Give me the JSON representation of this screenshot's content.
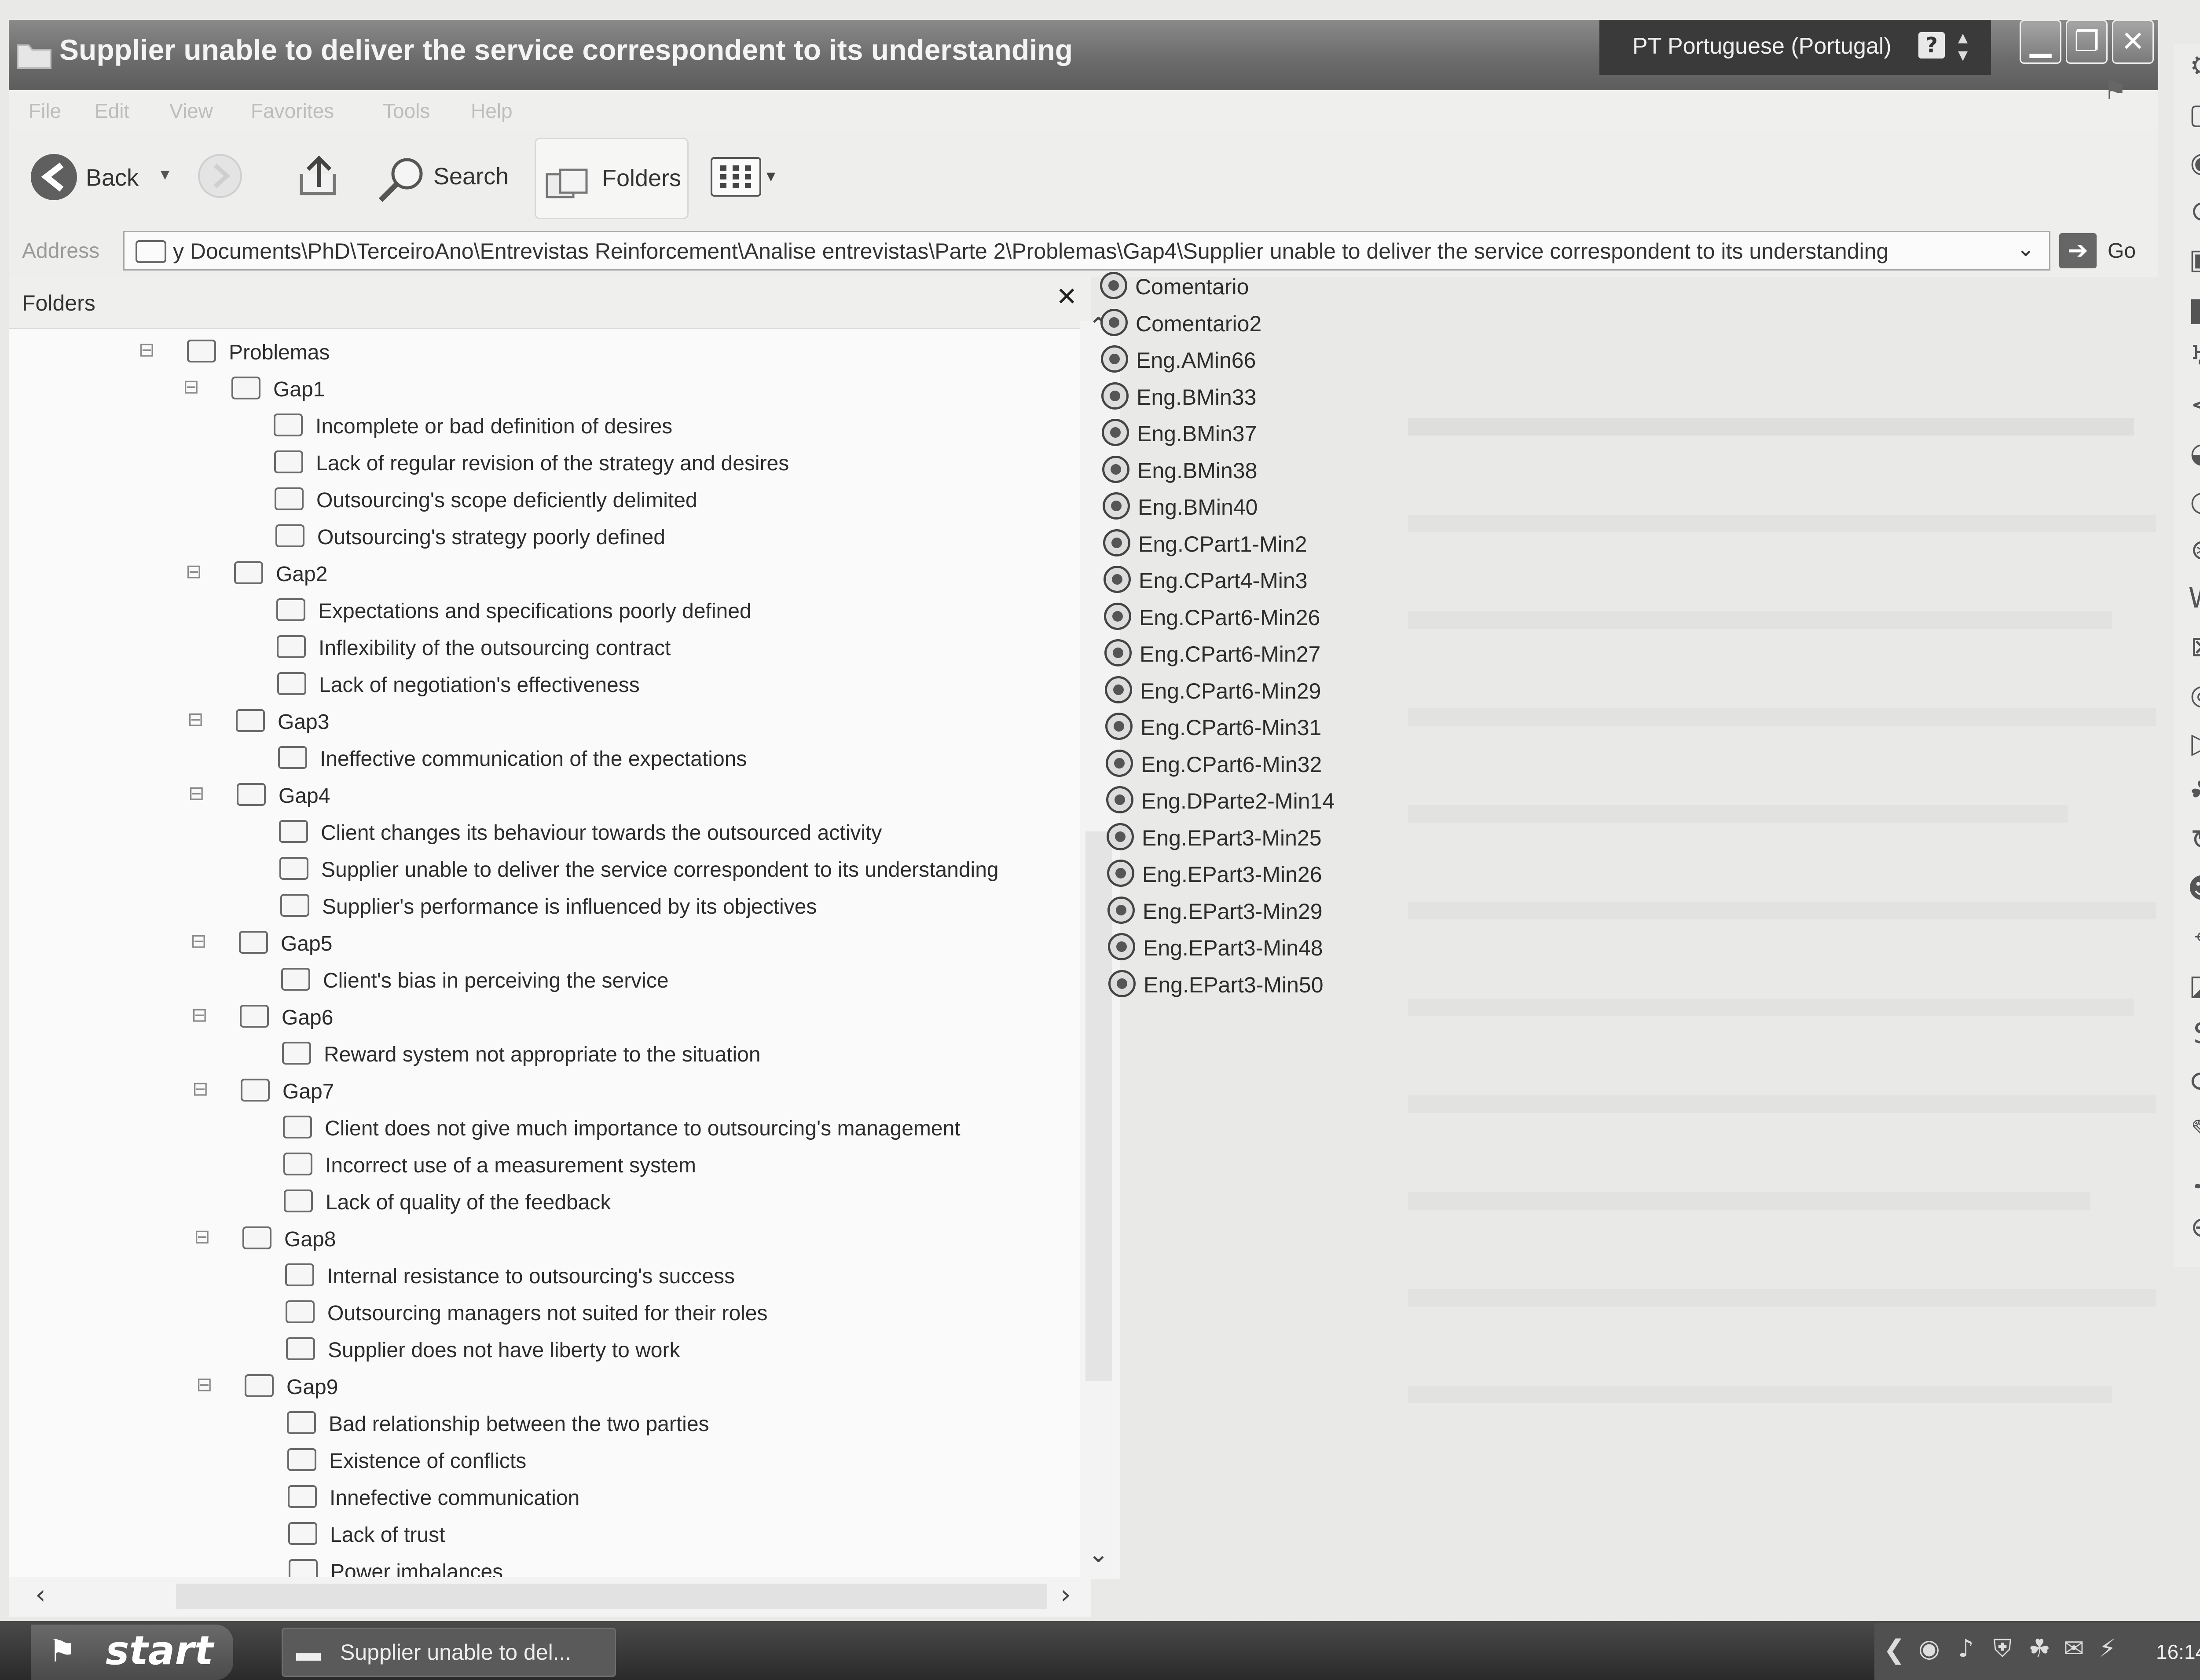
{
  "window": {
    "title": "Supplier unable to deliver the service correspondent to its understanding",
    "language": "PT Portuguese (Portugal)",
    "help_glyph": "?",
    "minimize_glyph": "▁",
    "restore_glyph": "❐",
    "close_glyph": "✕"
  },
  "menu": [
    "File",
    "Edit",
    "View",
    "Favorites",
    "Tools",
    "Help"
  ],
  "toolbar": {
    "back_label": "Back",
    "search_label": "Search",
    "folders_label": "Folders"
  },
  "address": {
    "label": "Address",
    "path": "y Documents\\PhD\\TerceiroAno\\Entrevistas Reinforcement\\Analise entrevistas\\Parte 2\\Problemas\\Gap4\\Supplier unable to deliver the service correspondent to its understanding",
    "go_label": "Go"
  },
  "folders_pane": {
    "title": "Folders",
    "close_glyph": "✕",
    "root": "Problemas",
    "gaps": [
      {
        "name": "Gap1",
        "items": [
          "Incomplete or bad definition of desires",
          "Lack of regular revision of the strategy and desires",
          "Outsourcing's scope deficiently delimited",
          "Outsourcing's strategy poorly defined"
        ]
      },
      {
        "name": "Gap2",
        "items": [
          "Expectations and specifications poorly defined",
          "Inflexibility of the outsourcing contract",
          "Lack of negotiation's effectiveness"
        ]
      },
      {
        "name": "Gap3",
        "items": [
          "Ineffective communication of the expectations"
        ]
      },
      {
        "name": "Gap4",
        "items": [
          "Client changes its behaviour towards the outsourced activity",
          "Supplier unable to deliver the service correspondent to its understanding",
          "Supplier's performance is influenced by its objectives"
        ]
      },
      {
        "name": "Gap5",
        "items": [
          "Client's bias in perceiving the service"
        ]
      },
      {
        "name": "Gap6",
        "items": [
          "Reward system not appropriate to the situation"
        ]
      },
      {
        "name": "Gap7",
        "items": [
          "Client does not give much importance to outsourcing's management",
          "Incorrect use of a measurement system",
          "Lack of quality of the feedback"
        ]
      },
      {
        "name": "Gap8",
        "items": [
          "Internal resistance to outsourcing's success",
          "Outsourcing managers not suited for their roles",
          "Supplier does not have liberty to work"
        ]
      },
      {
        "name": "Gap9",
        "items": [
          "Bad relationship between the two parties",
          "Existence of conflicts",
          "Innefective communication",
          "Lack of trust",
          "Power imbalances"
        ]
      }
    ]
  },
  "files": [
    "Comentario",
    "Comentario2",
    "Eng.AMin66",
    "Eng.BMin33",
    "Eng.BMin37",
    "Eng.BMin38",
    "Eng.BMin40",
    "Eng.CPart1-Min2",
    "Eng.CPart4-Min3",
    "Eng.CPart6-Min26",
    "Eng.CPart6-Min27",
    "Eng.CPart6-Min29",
    "Eng.CPart6-Min31",
    "Eng.CPart6-Min32",
    "Eng.DParte2-Min14",
    "Eng.EPart3-Min25",
    "Eng.EPart3-Min26",
    "Eng.EPart3-Min29",
    "Eng.EPart3-Min48",
    "Eng.EPart3-Min50"
  ],
  "taskbar": {
    "start_label": "start",
    "task_label": "Supplier unable to del...",
    "clock": "16:14"
  }
}
